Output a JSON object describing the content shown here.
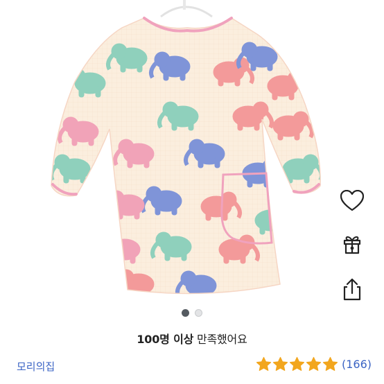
{
  "product": {
    "image_alt": "유아 코끼리 패턴 방수 가운",
    "slide_total": 2,
    "slide_current": 1
  },
  "actions": {
    "wishlist_icon": "heart-outline-icon",
    "gift_icon": "gift-icon",
    "share_icon": "share-icon"
  },
  "satisfaction": {
    "strong": "100명 이상",
    "rest": " 만족했어요"
  },
  "seller": {
    "name": "모리의집"
  },
  "rating": {
    "stars": 5,
    "count_label": "(166)",
    "star_color": "#f2a61e"
  },
  "colors": {
    "link": "#3a63c4",
    "garment_base": "#fbeede",
    "trim": "#f0a2bd"
  }
}
